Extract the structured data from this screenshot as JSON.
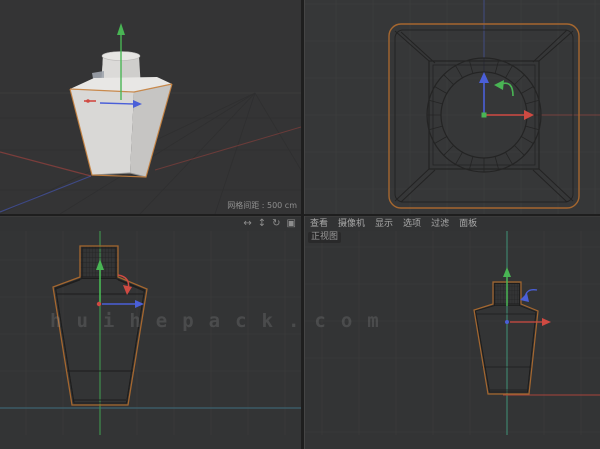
{
  "viewports": {
    "perspective": {
      "hud_text": "网格间距 : 500 cm"
    },
    "top": {},
    "right_view": {},
    "front_view": {
      "label": "正视图"
    }
  },
  "menu": {
    "items": [
      "查看",
      "摄像机",
      "显示",
      "选项",
      "过滤",
      "面板"
    ]
  },
  "controls": [
    {
      "name": "pan-camera-icon",
      "glyph": "↔"
    },
    {
      "name": "dolly-camera-icon",
      "glyph": "↕"
    },
    {
      "name": "rotate-camera-icon",
      "glyph": "↻"
    },
    {
      "name": "toggle-view-icon",
      "glyph": "▣"
    }
  ],
  "watermark": {
    "text": "huihepack.com"
  },
  "colors": {
    "selection_orange": "#c8823e",
    "wire_orange": "#a5672f",
    "axis_x_red": "#d04a42",
    "axis_y_green": "#49b554",
    "axis_z_blue": "#4a5fd8",
    "grid_line": "#3d3e3e",
    "wire_dark": "#1d1d1d",
    "viewport_bg": "#343435",
    "watermark_gray": "#8a8a8a",
    "hud_gray": "#8f8f8f"
  }
}
